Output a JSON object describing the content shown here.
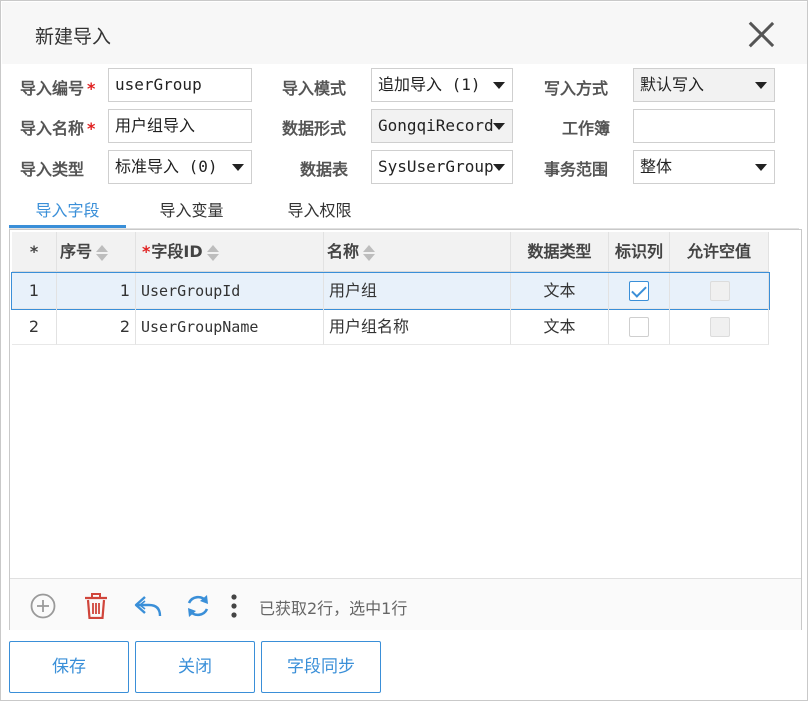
{
  "dialog": {
    "title": "新建导入"
  },
  "form": {
    "import_code": {
      "label": "导入编号",
      "value": "userGroup"
    },
    "import_name": {
      "label": "导入名称",
      "value": "用户组导入"
    },
    "import_type": {
      "label": "导入类型",
      "value": "标准导入 (0)"
    },
    "import_mode": {
      "label": "导入模式",
      "value": "追加导入 (1)"
    },
    "data_format": {
      "label": "数据形式",
      "value": "GongqiRecord"
    },
    "data_table": {
      "label": "数据表",
      "value": "SysUserGroup"
    },
    "write_mode": {
      "label": "写入方式",
      "value": "默认写入"
    },
    "workbook": {
      "label": "工作簿",
      "value": ""
    },
    "tx_scope": {
      "label": "事务范围",
      "value": "整体"
    },
    "required_mark": "*"
  },
  "tabs": [
    {
      "label": "导入字段",
      "active": true
    },
    {
      "label": "导入变量",
      "active": false
    },
    {
      "label": "导入权限",
      "active": false
    }
  ],
  "grid": {
    "columns": {
      "star": "*",
      "seq": "序号",
      "field_id": "字段ID",
      "name": "名称",
      "data_type": "数据类型",
      "identity": "标识列",
      "nullable": "允许空值"
    },
    "rows": [
      {
        "index": "1",
        "seq": "1",
        "field_id": "UserGroupId",
        "name": "用户组",
        "data_type": "文本",
        "identity": true,
        "nullable": false,
        "selected": true
      },
      {
        "index": "2",
        "seq": "2",
        "field_id": "UserGroupName",
        "name": "用户组名称",
        "data_type": "文本",
        "identity": false,
        "nullable": false,
        "selected": false
      }
    ],
    "status": "已获取2行，选中1行"
  },
  "buttons": {
    "save": "保存",
    "close": "关闭",
    "sync": "字段同步"
  },
  "colors": {
    "accent": "#3a8fd8",
    "delete": "#d0453b",
    "required": "#e02020"
  }
}
